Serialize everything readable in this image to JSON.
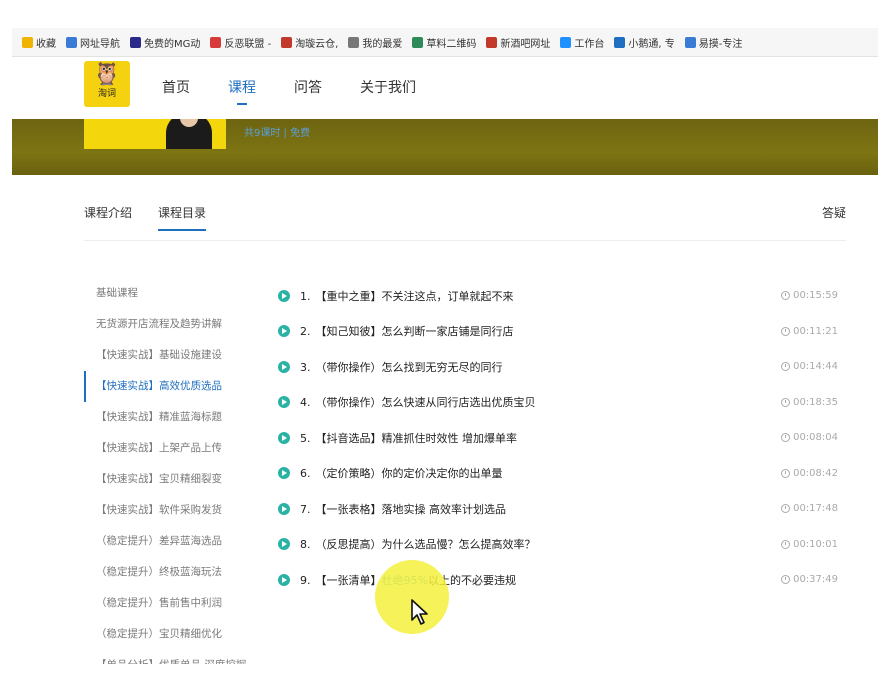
{
  "bookmarks": [
    {
      "label": "收藏",
      "icon": "star-icon",
      "color": "#f0b400"
    },
    {
      "label": "网址导航",
      "icon": "globe-icon",
      "color": "#3a7bd5"
    },
    {
      "label": "免费的MG动",
      "icon": "bookmark-icon",
      "color": "#2a2a8a"
    },
    {
      "label": "反恶联盟 -",
      "icon": "shield-icon",
      "color": "#d83a3a"
    },
    {
      "label": "淘璇云仓,",
      "icon": "b-icon",
      "color": "#c0392b"
    },
    {
      "label": "我的最爱",
      "icon": "grid-icon",
      "color": "#777777"
    },
    {
      "label": "草料二维码",
      "icon": "qr-icon",
      "color": "#2e8b57"
    },
    {
      "label": "新酒吧网址",
      "icon": "n-icon",
      "color": "#c0392b"
    },
    {
      "label": "工作台",
      "icon": "chat-icon",
      "color": "#1e90ff"
    },
    {
      "label": "小鹅通, 专",
      "icon": "circle-icon",
      "color": "#1e6fc2"
    },
    {
      "label": "易摸-专注",
      "icon": "pin-icon",
      "color": "#3a7bd5"
    }
  ],
  "site": {
    "logo_text": "淘词",
    "nav": [
      "首页",
      "课程",
      "问答",
      "关于我们"
    ],
    "nav_active": 1
  },
  "banner": {
    "subtitle": "共9课时 | 免费"
  },
  "tabs": {
    "intro": "课程介绍",
    "catalog": "课程目录",
    "qa": "答疑"
  },
  "sidebar": [
    "基础课程",
    "无货源开店流程及趋势讲解",
    "【快速实战】基础设施建设",
    "【快速实战】高效优质选品",
    "【快速实战】精准蓝海标题",
    "【快速实战】上架产品上传",
    "【快速实战】宝贝精细裂变",
    "【快速实战】软件采购发货",
    "（稳定提升）差异蓝海选品",
    "（稳定提升）终极蓝海玩法",
    "（稳定提升）售前售中利润",
    "（稳定提升）宝贝精细优化",
    "【单品分析】优质单品 深度挖掘"
  ],
  "sidebar_active": 3,
  "lessons": [
    {
      "num": "1.",
      "pre": "【重中之重】不关注这点，订单就起不来",
      "hl": "",
      "post": "",
      "duration": "00:15:59"
    },
    {
      "num": "2.",
      "pre": "【知己知彼】怎么判断一家店铺是同行店",
      "hl": "",
      "post": "",
      "duration": "00:11:21"
    },
    {
      "num": "3.",
      "pre": "（带你操作）怎么找到无穷无尽的同行",
      "hl": "",
      "post": "",
      "duration": "00:14:44"
    },
    {
      "num": "4.",
      "pre": "（带你操作）怎么快速从同行店选出优质宝贝",
      "hl": "",
      "post": "",
      "duration": "00:18:35"
    },
    {
      "num": "5.",
      "pre": "【抖音选品】精准抓住时效性 增加爆单率",
      "hl": "",
      "post": "",
      "duration": "00:08:04"
    },
    {
      "num": "6.",
      "pre": "（定价策略）你的定价决定你的出单量",
      "hl": "",
      "post": "",
      "duration": "00:08:42"
    },
    {
      "num": "7.",
      "pre": "【一张表格】落地实操 高效率计划选品",
      "hl": "",
      "post": "",
      "duration": "00:17:48"
    },
    {
      "num": "8.",
      "pre": "（反思提高）为什么选品慢？怎么提高效率？",
      "hl": "",
      "post": "",
      "duration": "00:10:01"
    },
    {
      "num": "9.",
      "pre": "【一张清单】",
      "hl": "杜绝95%",
      "post": "以上的不必要违规",
      "duration": "00:37:49"
    }
  ]
}
